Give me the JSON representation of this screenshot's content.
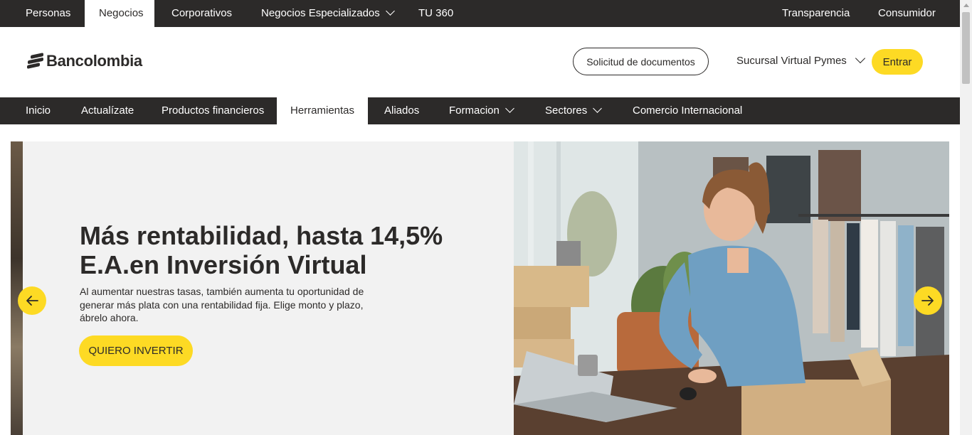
{
  "topbar": {
    "tabs": [
      {
        "label": "Personas"
      },
      {
        "label": "Negocios",
        "active": true
      },
      {
        "label": "Corporativos"
      },
      {
        "label": "Negocios Especializados",
        "has_dropdown": true
      },
      {
        "label": "TU 360"
      }
    ],
    "right_links": [
      {
        "label": "Transparencia"
      },
      {
        "label": "Consumidor"
      }
    ]
  },
  "header": {
    "logo_text": "Bancolombia",
    "docs_button": "Solicitud de documentos",
    "sucursal_label": "Sucursal Virtual Pymes",
    "login_button": "Entrar"
  },
  "nav": {
    "items": [
      {
        "label": "Inicio"
      },
      {
        "label": "Actualízate"
      },
      {
        "label": "Productos financieros"
      },
      {
        "label": "Herramientas",
        "active": true
      },
      {
        "label": "Aliados"
      },
      {
        "label": "Formacion",
        "has_dropdown": true
      },
      {
        "label": "Sectores",
        "has_dropdown": true
      },
      {
        "label": "Comercio Internacional"
      }
    ]
  },
  "hero": {
    "title_line1": "Más rentabilidad, hasta 14,5%",
    "title_line2": "E.A.en Inversión Virtual",
    "description": "Al aumentar nuestras tasas, también aumenta tu oportunidad de generar más plata con una rentabilidad fija. Elige monto y plazo, ábrelo ahora.",
    "cta_button": "QUIERO INVERTIR",
    "prev_icon": "arrow-left-icon",
    "next_icon": "arrow-right-icon"
  },
  "colors": {
    "brand_yellow": "#fdda24",
    "dark": "#2c2a29",
    "hero_bg": "#f2f2f2"
  }
}
